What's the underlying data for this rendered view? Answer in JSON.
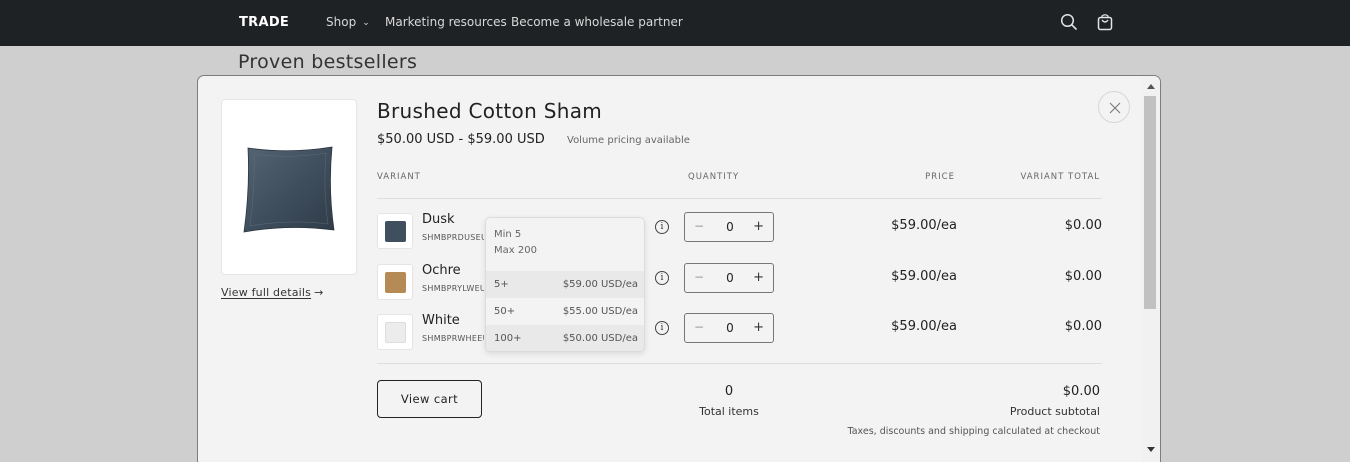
{
  "nav": {
    "brand": "TRADE",
    "links": [
      "Shop",
      "Marketing resources",
      "Become a wholesale partner"
    ],
    "icons": [
      "search-icon",
      "cart-icon",
      "chevron-down-icon"
    ]
  },
  "background_heading": "Proven bestsellers",
  "modal": {
    "title": "Brushed Cotton Sham",
    "price_range": "$50.00 USD - $59.00 USD",
    "volume_note": "Volume pricing available",
    "view_full_details": "View full details",
    "columns": {
      "variant": "VARIANT",
      "quantity": "QUANTITY",
      "price": "PRICE",
      "variant_total": "VARIANT TOTAL"
    },
    "rows": [
      {
        "name": "Dusk",
        "sku": "SHMBPRDUSEU",
        "qty": "0",
        "price": "$59.00/ea",
        "total": "$0.00",
        "swatch": "#3f4f5e"
      },
      {
        "name": "Ochre",
        "sku": "SHMBPRYLWEU",
        "qty": "0",
        "price": "$59.00/ea",
        "total": "$0.00",
        "swatch": "#b48a55"
      },
      {
        "name": "White",
        "sku": "SHMBPRWHEEU",
        "qty": "0",
        "price": "$59.00/ea",
        "total": "$0.00",
        "swatch": "#ececec"
      }
    ],
    "volume_popover": {
      "min": "Min 5",
      "max": "Max 200",
      "tiers": [
        {
          "qty": "5+",
          "price": "$59.00 USD/ea"
        },
        {
          "qty": "50+",
          "price": "$55.00 USD/ea"
        },
        {
          "qty": "100+",
          "price": "$50.00 USD/ea"
        }
      ]
    },
    "footer": {
      "view_cart": "View cart",
      "total_items": "0",
      "total_items_label": "Total items",
      "subtotal": "$0.00",
      "subtotal_label": "Product subtotal",
      "tax_note": "Taxes, discounts and shipping calculated at checkout"
    },
    "stepper": {
      "minus": "−",
      "plus": "+"
    },
    "info_glyph": "i",
    "arrow_glyph": "→"
  },
  "colors": {
    "nav_bg": "#1f2224",
    "overlay": "#cfcfcf",
    "modal_bg": "#f3f3f3",
    "dusk": "#3f4f5e",
    "ochre": "#b48a55",
    "white": "#ececec"
  }
}
